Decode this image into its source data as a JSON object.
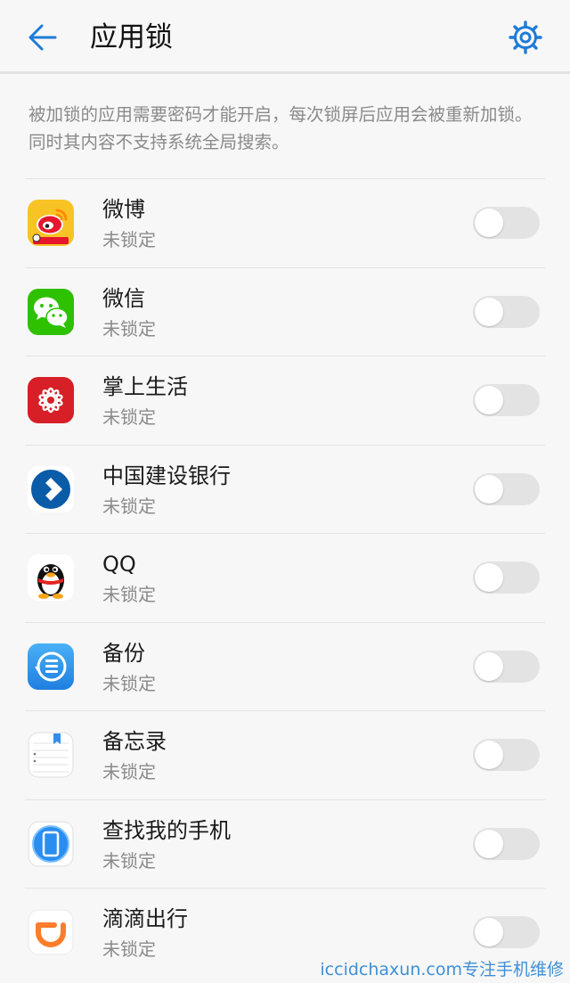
{
  "header": {
    "title": "应用锁",
    "back_icon": "arrow-left-icon",
    "settings_icon": "gear-icon",
    "accent_color": "#1e7bd8"
  },
  "description": "被加锁的应用需要密码才能开启，每次锁屏后应用会被重新加锁。同时其内容不支持系统全局搜索。",
  "apps": [
    {
      "name": "微博",
      "status": "未锁定",
      "icon": "weibo-icon",
      "locked": false
    },
    {
      "name": "微信",
      "status": "未锁定",
      "icon": "wechat-icon",
      "locked": false
    },
    {
      "name": "掌上生活",
      "status": "未锁定",
      "icon": "zhangshang-shenghuo-icon",
      "locked": false
    },
    {
      "name": "中国建设银行",
      "status": "未锁定",
      "icon": "ccb-icon",
      "locked": false
    },
    {
      "name": "QQ",
      "status": "未锁定",
      "icon": "qq-penguin-icon",
      "locked": false
    },
    {
      "name": "备份",
      "status": "未锁定",
      "icon": "backup-icon",
      "locked": false
    },
    {
      "name": "备忘录",
      "status": "未锁定",
      "icon": "notepad-icon",
      "locked": false
    },
    {
      "name": "查找我的手机",
      "status": "未锁定",
      "icon": "find-phone-icon",
      "locked": false
    },
    {
      "name": "滴滴出行",
      "status": "未锁定",
      "icon": "didi-icon",
      "locked": false
    }
  ],
  "watermark": "iccidchaxun.com专注手机维修"
}
